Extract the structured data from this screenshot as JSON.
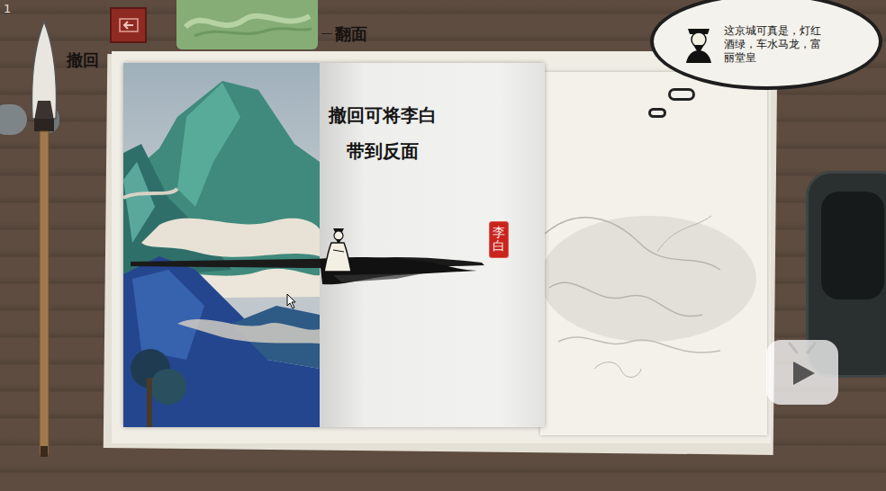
{
  "corner_text": "1",
  "toolbar": {
    "undo": {
      "label": "撤回"
    },
    "flip": {
      "label": "翻面"
    }
  },
  "hint": {
    "lines": [
      "撤回可将李白",
      "带到反面"
    ]
  },
  "character": {
    "seal": "李白"
  },
  "thought": {
    "text": "这京城可真是，灯红酒绿，车水马龙，富丽堂皇"
  }
}
